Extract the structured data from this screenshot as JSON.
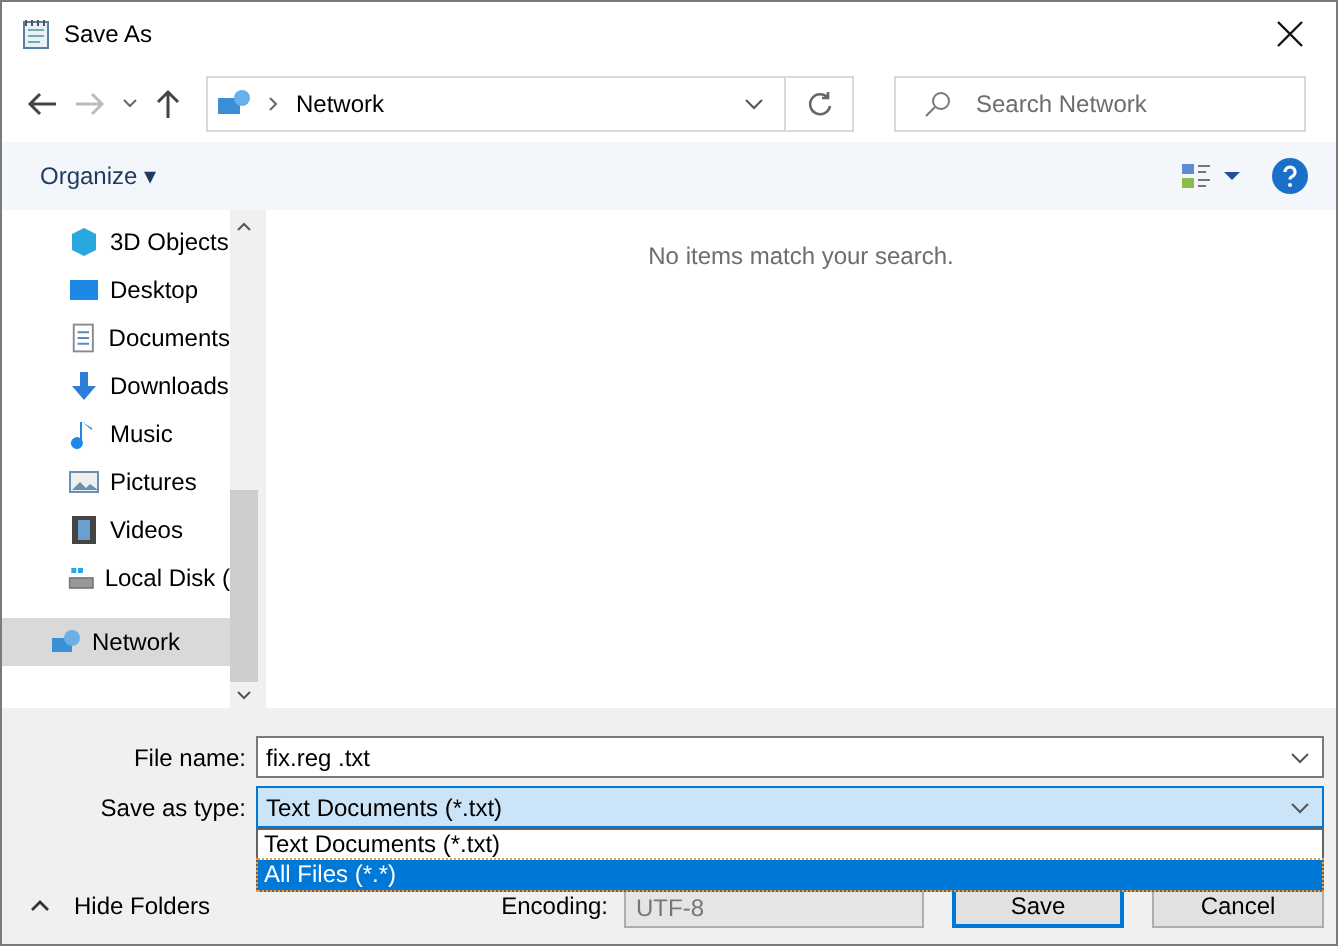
{
  "window": {
    "title": "Save As"
  },
  "address": {
    "location": "Network",
    "search_placeholder": "Search Network"
  },
  "toolbar": {
    "organize": "Organize ▾"
  },
  "sidebar": {
    "items": [
      {
        "label": "3D Objects",
        "kind": "cube",
        "selected": false
      },
      {
        "label": "Desktop",
        "kind": "desktop",
        "selected": false
      },
      {
        "label": "Documents",
        "kind": "document",
        "selected": false
      },
      {
        "label": "Downloads",
        "kind": "download",
        "selected": false
      },
      {
        "label": "Music",
        "kind": "music",
        "selected": false
      },
      {
        "label": "Pictures",
        "kind": "pictures",
        "selected": false
      },
      {
        "label": "Videos",
        "kind": "videos",
        "selected": false
      },
      {
        "label": "Local Disk (",
        "kind": "disk",
        "selected": false
      },
      {
        "label": "Network",
        "kind": "network",
        "selected": true
      }
    ]
  },
  "content": {
    "empty_message": "No items match your search."
  },
  "form": {
    "file_name_label": "File name:",
    "file_name": "fix.reg .txt",
    "type_label": "Save as type:",
    "type": "Text Documents (*.txt)",
    "type_options": [
      {
        "label": "Text Documents (*.txt)",
        "selected": false
      },
      {
        "label": "All Files  (*.*)",
        "selected": true
      }
    ],
    "encoding_label": "Encoding:",
    "encoding": "UTF-8"
  },
  "footer": {
    "hide_folders": "Hide Folders",
    "save": "Save",
    "cancel": "Cancel"
  }
}
